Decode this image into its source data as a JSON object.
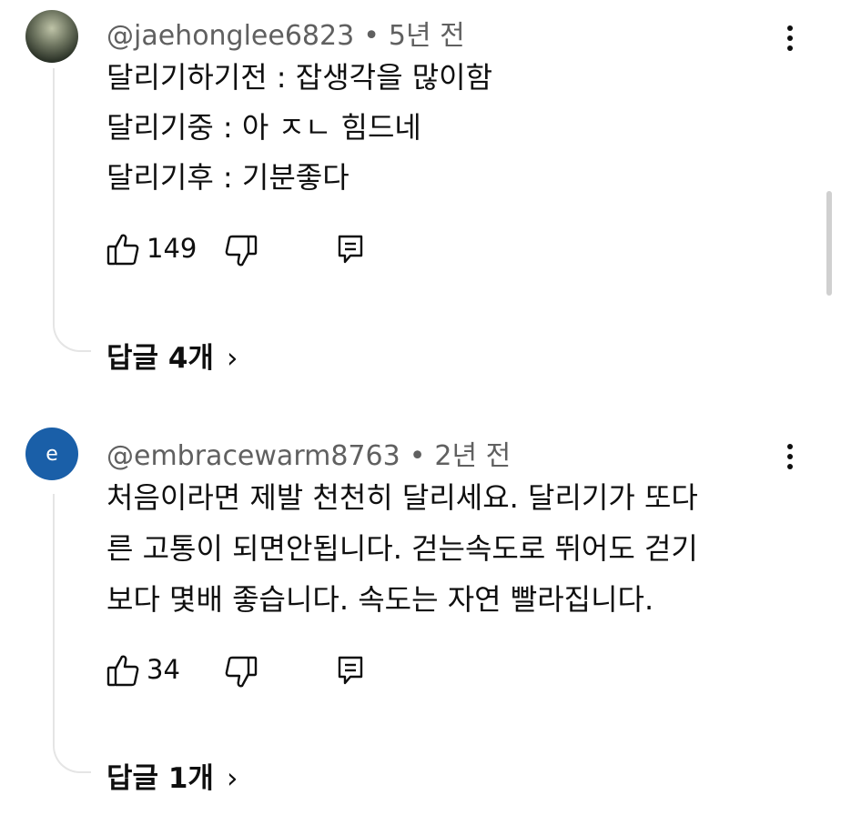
{
  "comments": [
    {
      "author": "@jaehonglee6823",
      "time": "5년 전",
      "lines": [
        "달리기하기전 : 잡생각을 많이함",
        "달리기중 : 아 ㅈㄴ 힘드네",
        "달리기후 : 기분좋다"
      ],
      "likes": "149",
      "replies": "답글 4개",
      "avatar": "photo"
    },
    {
      "author": "@embracewarm8763",
      "time": "2년 전",
      "lines": [
        "처음이라면  제발  천천히 달리세요. 달리기가 또다",
        "른 고통이 되면안됩니다. 걷는속도로  뛰어도 걷기",
        "보다 몇배 좋습니다. 속도는 자연  빨라집니다."
      ],
      "likes": "34",
      "replies": "답글 1개",
      "avatar_letter": "e"
    }
  ],
  "separator": "•",
  "chevron": "›",
  "colors": {
    "avatar_blue": "#1a5fa8",
    "thread_line": "#e5e5e5",
    "meta_gray": "#606060"
  }
}
